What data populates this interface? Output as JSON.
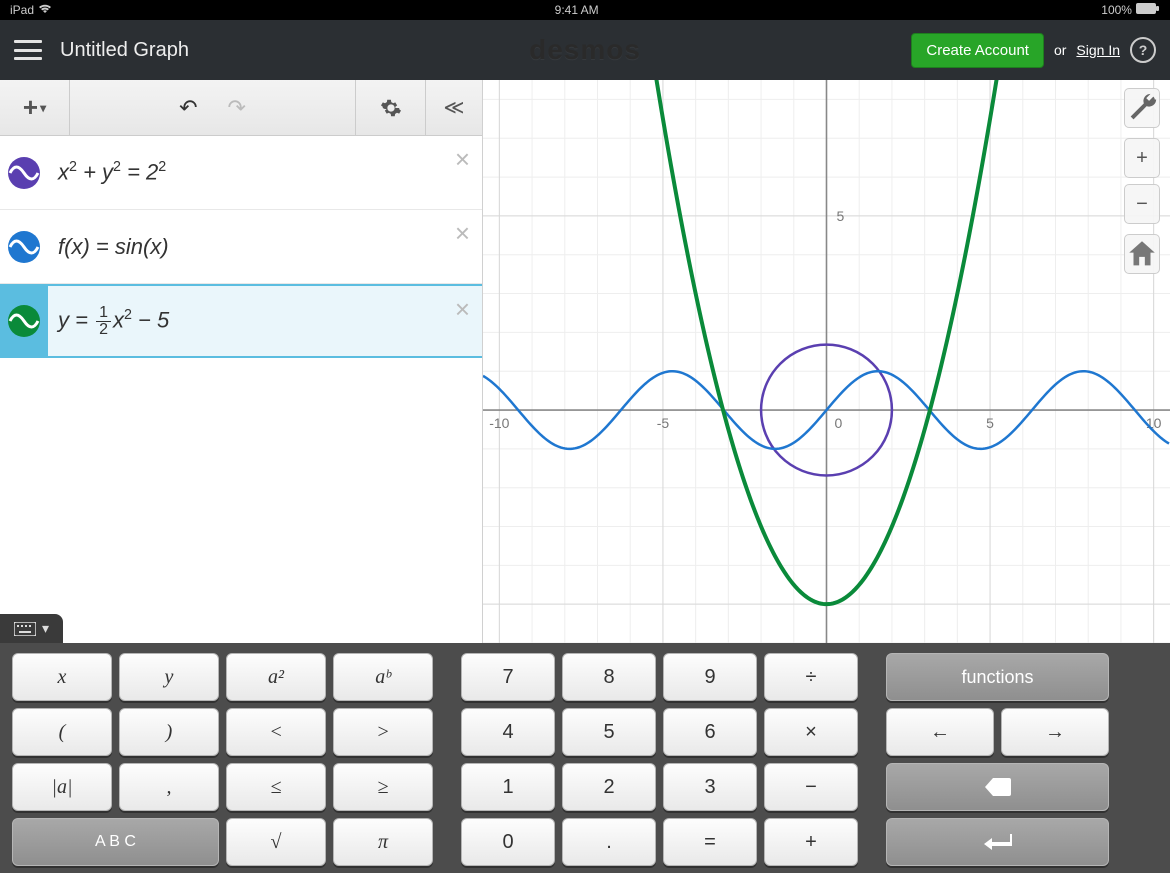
{
  "status": {
    "device": "iPad",
    "time": "9:41 AM",
    "battery": "100%"
  },
  "header": {
    "title": "Untitled Graph",
    "logo": "desmos",
    "create_account": "Create Account",
    "or": "or",
    "sign_in": "Sign In"
  },
  "expressions": [
    {
      "color": "#5a3fb0",
      "latex_html": "x<sup>2</sup> + y<sup>2</sup> = 2<sup>2</sup>",
      "selected": false
    },
    {
      "color": "#1f77d0",
      "latex_html": "f(x) = sin(x)",
      "selected": false
    },
    {
      "color": "#0a8a3a",
      "latex_html": "y = <span class='frac'><span class='n'>1</span><span class='d'>2</span></span>x<sup>2</sup> − 5",
      "selected": true
    }
  ],
  "keyboard": {
    "group_a": [
      "x",
      "y",
      "a²",
      "aᵇ",
      "(",
      ")",
      "<",
      ">",
      "|a|",
      ",",
      "≤",
      "≥",
      "A B C",
      "√",
      "π"
    ],
    "group_b": [
      "7",
      "8",
      "9",
      "÷",
      "4",
      "5",
      "6",
      "×",
      "1",
      "2",
      "3",
      "−",
      "0",
      ".",
      "=",
      "+"
    ],
    "group_c_functions": "functions"
  },
  "chart_data": {
    "type": "line",
    "xlim": [
      -10.5,
      10.5
    ],
    "ylim": [
      -6,
      8.5
    ],
    "xticks": [
      -10,
      -5,
      0,
      5,
      10
    ],
    "yticks": [
      5
    ],
    "series": [
      {
        "name": "x^2 + y^2 = 4 (circle)",
        "type": "implicit",
        "center": [
          0,
          0
        ],
        "radius": 2,
        "color": "#5a3fb0"
      },
      {
        "name": "f(x)=sin(x)",
        "type": "function",
        "expr": "sin(x)",
        "color": "#1f77d0"
      },
      {
        "name": "y=0.5x^2-5",
        "type": "function",
        "expr": "0.5*x*x-5",
        "color": "#0a8a3a"
      }
    ]
  }
}
